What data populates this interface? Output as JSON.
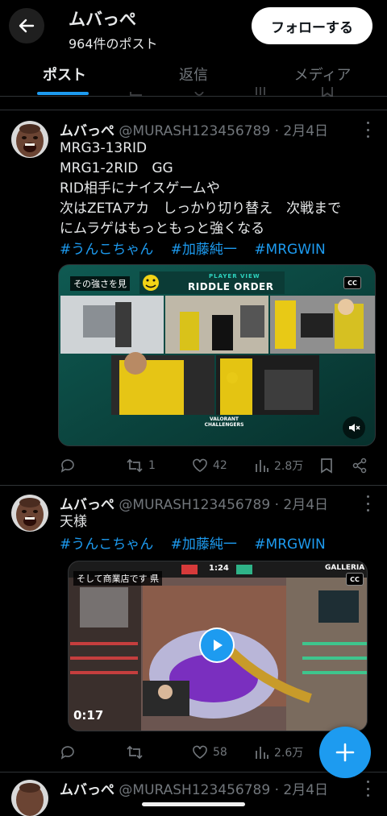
{
  "header": {
    "title": "ムバっぺ",
    "post_count": "964件のポスト",
    "follow_label": "フォローする"
  },
  "tabs": [
    {
      "label": "ポスト",
      "active": true
    },
    {
      "label": "返信",
      "active": false
    },
    {
      "label": "メディア",
      "active": false
    }
  ],
  "posts": [
    {
      "name": "ムバっぺ",
      "handle": "@MURASH123456789",
      "date": "· 2月4日",
      "lines": [
        "MRG3-13RID",
        "MRG1-2RID　GG",
        "RID相手にナイスゲームや",
        "次はZETAアカ　しっかり切り替え　次戦まで",
        "にムラゲはもっともっと強くなる"
      ],
      "hashtags": [
        "#うんこちゃん",
        "#加藤純一",
        "#MRGWIN"
      ],
      "media": {
        "label": "その強さを見",
        "banner_small": "PLAYER VIEW",
        "banner_title": "RIDDLE ORDER",
        "cc": "CC",
        "footer": "VALORANT CHALLENGERS"
      },
      "stats": {
        "retweets": "1",
        "likes": "42",
        "views": "2.8万"
      }
    },
    {
      "name": "ムバっぺ",
      "handle": "@MURASH123456789",
      "date": "· 2月4日",
      "lines": [
        "天様"
      ],
      "hashtags": [
        "#うんこちゃん",
        "#加藤純一",
        "#MRGWIN"
      ],
      "media": {
        "label": "そして商業店です 県",
        "cc": "CC",
        "timer": "0:17",
        "round_time": "1:24",
        "brand": "GALLERIA"
      },
      "stats": {
        "retweets": "",
        "likes": "58",
        "views": "2.6万"
      }
    },
    {
      "name": "ムバっぺ",
      "handle": "@MURASH123456789",
      "date": "· 2月4日"
    }
  ],
  "colors": {
    "accent": "#1d9bf0",
    "muted": "#71767b",
    "background": "#000000"
  }
}
